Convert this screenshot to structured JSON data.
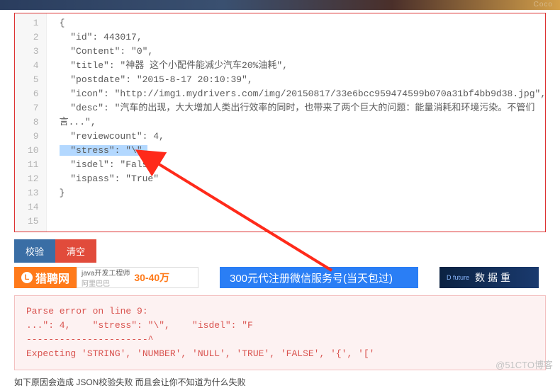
{
  "top_right": "Coco",
  "code_lines": [
    "{",
    "  \"id\": 443017,",
    "  \"Content\": \"0\",",
    "  \"title\": \"神器 这个小配件能减少汽车20%油耗\",",
    "  \"postdate\": \"2015-8-17 20:10:39\",",
    "  \"icon\": \"http://img1.mydrivers.com/img/20150817/33e6bcc959474599b070a31bf4bb9d38.jpg\",",
    "  \"desc\": \"汽车的出现，大大增加人类出行效率的同时，也带来了两个巨大的问题：能量消耗和环境污染。不管们",
    "言...\",",
    "  \"reviewcount\": 4,",
    "  \"stress\": \"\\\",",
    "  \"isdel\": \"False\"",
    "  \"ispass\": \"True\"",
    "}",
    "",
    ""
  ],
  "highlight_prefix": "  \"stress\": \"\\\",",
  "buttons": {
    "validate": "校验",
    "clear": "清空"
  },
  "ads": {
    "a1_brand": "猎聘网",
    "a1_job": "java开发工程师",
    "a1_sub": "阿里巴巴",
    "a1_salary": "30-40万",
    "a2": "300元代注册微信服务号(当天包过)",
    "a3_logo": "D future",
    "a3_text": "数据重"
  },
  "error_lines": [
    "Parse error on line 9:",
    "...\": 4,    \"stress\": \"\\\",    \"isdel\": \"F",
    "----------------------^",
    "Expecting 'STRING', 'NUMBER', 'NULL', 'TRUE', 'FALSE', '{', '['"
  ],
  "footer": "如下原因会造成 JSON校验失败 而且会让你不知道为什么失败",
  "watermark": "@51CTO博客"
}
